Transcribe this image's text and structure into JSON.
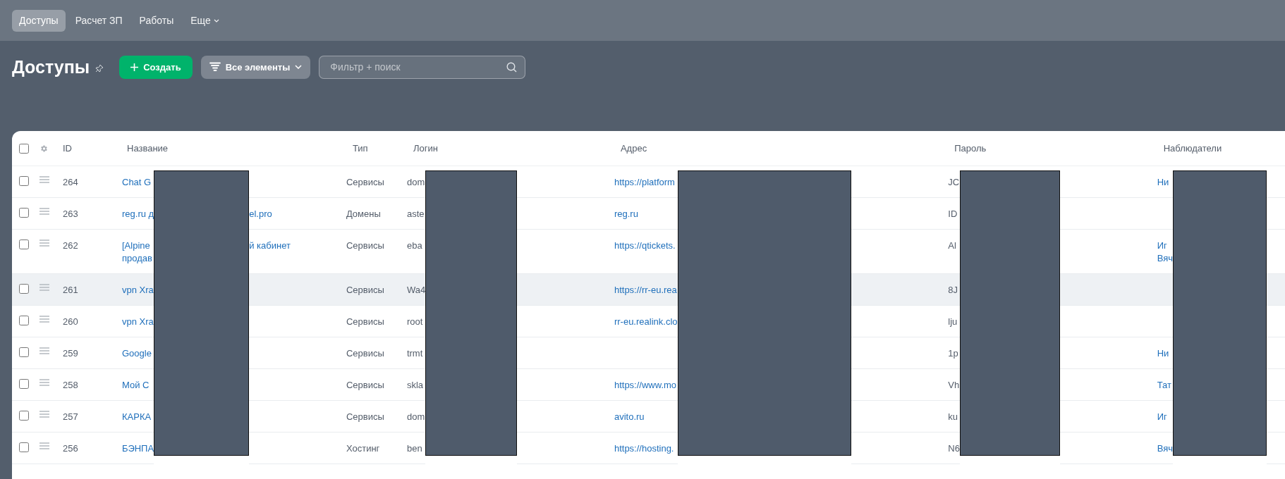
{
  "nav": {
    "tabs": [
      {
        "label": "Доступы",
        "selected": true,
        "has_menu": false
      },
      {
        "label": "Расчет ЗП",
        "selected": false,
        "has_menu": false
      },
      {
        "label": "Работы",
        "selected": false,
        "has_menu": false
      },
      {
        "label": "Еще",
        "selected": false,
        "has_menu": true
      }
    ]
  },
  "page": {
    "title": "Доступы",
    "create_button": "Создать",
    "filter_button": "Все элементы",
    "search": {
      "placeholder": "Фильтр + поиск"
    }
  },
  "table": {
    "select_all": {
      "checked": false
    },
    "columns": [
      "ID",
      "Название",
      "Тип",
      "Логин",
      "Адрес",
      "Пароль",
      "Наблюдатели"
    ],
    "rows": [
      {
        "id": "264",
        "name": [
          {
            "left": "Chat G"
          }
        ],
        "type": "Сервисы",
        "login": "dom",
        "address": "https://platform",
        "password": "JC",
        "watchers": [
          "Ни"
        ],
        "checked": false,
        "hovered": false
      },
      {
        "id": "263",
        "name": [
          {
            "left": "reg.ru д",
            "right": "el.pro"
          }
        ],
        "type": "Домены",
        "login": "aste",
        "address": "reg.ru",
        "password": "ID",
        "watchers": [],
        "checked": false,
        "hovered": false
      },
      {
        "id": "262",
        "name": [
          {
            "left": "[Alpine",
            "right": "й кабинет"
          },
          {
            "left": "продав"
          }
        ],
        "type": "Сервисы",
        "login": "eba",
        "address": "https://qtickets.",
        "password": "Al",
        "watchers": [
          "Иг",
          "Вяч"
        ],
        "checked": false,
        "hovered": false
      },
      {
        "id": "261",
        "name": [
          {
            "left": "vpn Xra"
          }
        ],
        "type": "Сервисы",
        "login": "Wa4",
        "address": "https://rr-eu.rea",
        "password": "8J",
        "watchers": [],
        "checked": false,
        "hovered": true
      },
      {
        "id": "260",
        "name": [
          {
            "left": "vpn Xra"
          }
        ],
        "type": "Сервисы",
        "login": "root",
        "address": "rr-eu.realink.clo",
        "password": "lju",
        "watchers": [],
        "checked": false,
        "hovered": false
      },
      {
        "id": "259",
        "name": [
          {
            "left": "Google"
          }
        ],
        "type": "Сервисы",
        "login": "trmt",
        "password": "1p",
        "watchers": [
          "Ни"
        ],
        "checked": false,
        "hovered": false
      },
      {
        "id": "258",
        "name": [
          {
            "left": "Мой С"
          }
        ],
        "type": "Сервисы",
        "login": "skla",
        "address": "https://www.mo",
        "password": "Vh",
        "watchers": [
          "Тат"
        ],
        "checked": false,
        "hovered": false
      },
      {
        "id": "257",
        "name": [
          {
            "left": "КАРКА"
          }
        ],
        "type": "Сервисы",
        "login": "dom",
        "address": "avito.ru",
        "password": "ku",
        "watchers": [
          "Иг"
        ],
        "checked": false,
        "hovered": false
      },
      {
        "id": "256",
        "name": [
          {
            "left": "БЭНПА"
          }
        ],
        "type": "Хостинг",
        "login": "ben",
        "address": "https://hosting.",
        "password": "N6",
        "watchers": [
          "Вяч"
        ],
        "checked": false,
        "hovered": false
      }
    ]
  }
}
